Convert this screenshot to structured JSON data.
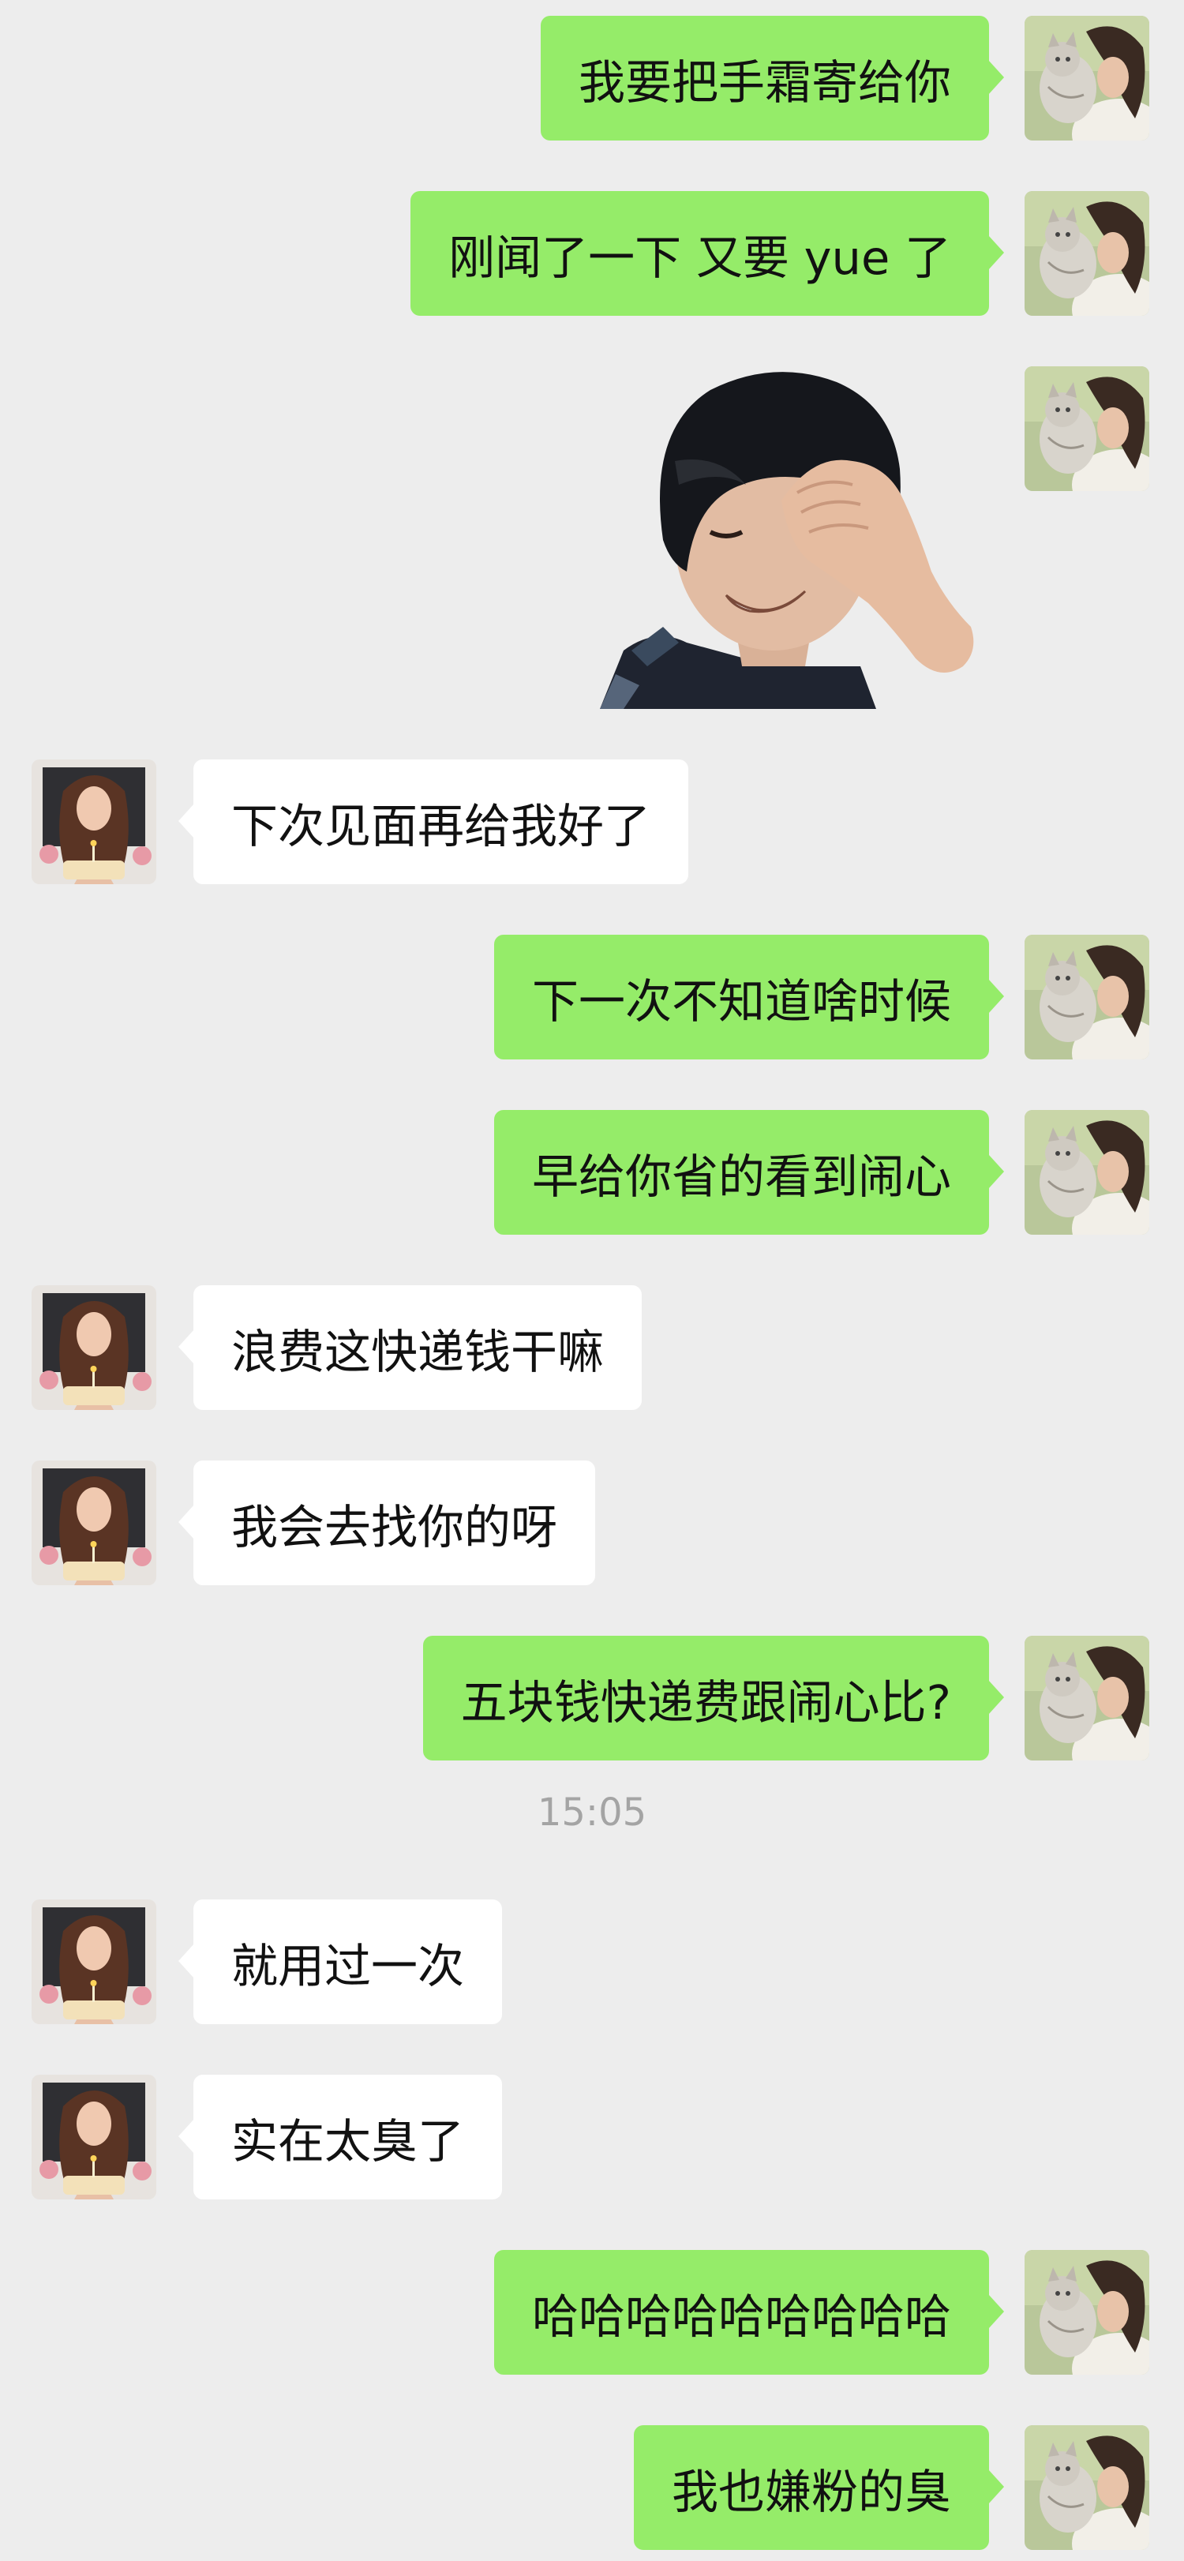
{
  "colors": {
    "background": "#ededed",
    "sent_bubble": "#95ec69",
    "received_bubble": "#ffffff",
    "timestamp_text": "#a4a4a4"
  },
  "messages": [
    {
      "sender": "me",
      "text": "我要把手霜寄给你"
    },
    {
      "sender": "me",
      "text": "刚闻了一下 又要 yue 了"
    },
    {
      "sender": "me",
      "type": "sticker",
      "sticker": "laughing-facepalm-sticker"
    },
    {
      "sender": "other",
      "text": "下次见面再给我好了"
    },
    {
      "sender": "me",
      "text": "下一次不知道啥时候"
    },
    {
      "sender": "me",
      "text": "早给你省的看到闹心"
    },
    {
      "sender": "other",
      "text": "浪费这快递钱干嘛"
    },
    {
      "sender": "other",
      "text": "我会去找你的呀"
    },
    {
      "sender": "me",
      "text": "五块钱快递费跟闹心比?"
    },
    {
      "sender": "other",
      "text": "就用过一次"
    },
    {
      "sender": "other",
      "text": "实在太臭了"
    },
    {
      "sender": "me",
      "text": "哈哈哈哈哈哈哈哈哈"
    },
    {
      "sender": "me",
      "text": "我也嫌粉的臭"
    }
  ],
  "timestamp": "15:05"
}
